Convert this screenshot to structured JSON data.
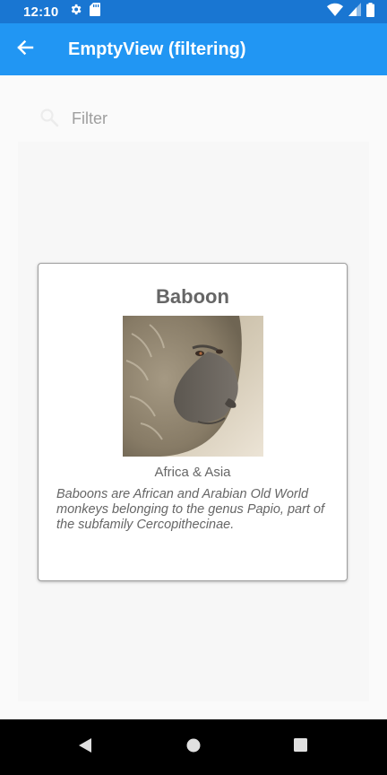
{
  "status_bar": {
    "time": "12:10",
    "icons": [
      "gear-icon",
      "sd-card-icon",
      "wifi-icon",
      "signal-icon",
      "battery-icon"
    ]
  },
  "app_bar": {
    "title": "EmptyView (filtering)",
    "back_icon": "arrow-back-icon",
    "color": "#2196f3"
  },
  "search": {
    "placeholder": "Filter",
    "value": "",
    "icon": "search-icon"
  },
  "card": {
    "title": "Baboon",
    "location": "Africa & Asia",
    "description": "Baboons are African and Arabian Old World monkeys belonging to the genus Papio, part of the subfamily Cercopithecinae.",
    "image": "baboon-photo"
  },
  "nav_bar": {
    "buttons": [
      "back-triangle-icon",
      "home-circle-icon",
      "recents-square-icon"
    ]
  }
}
